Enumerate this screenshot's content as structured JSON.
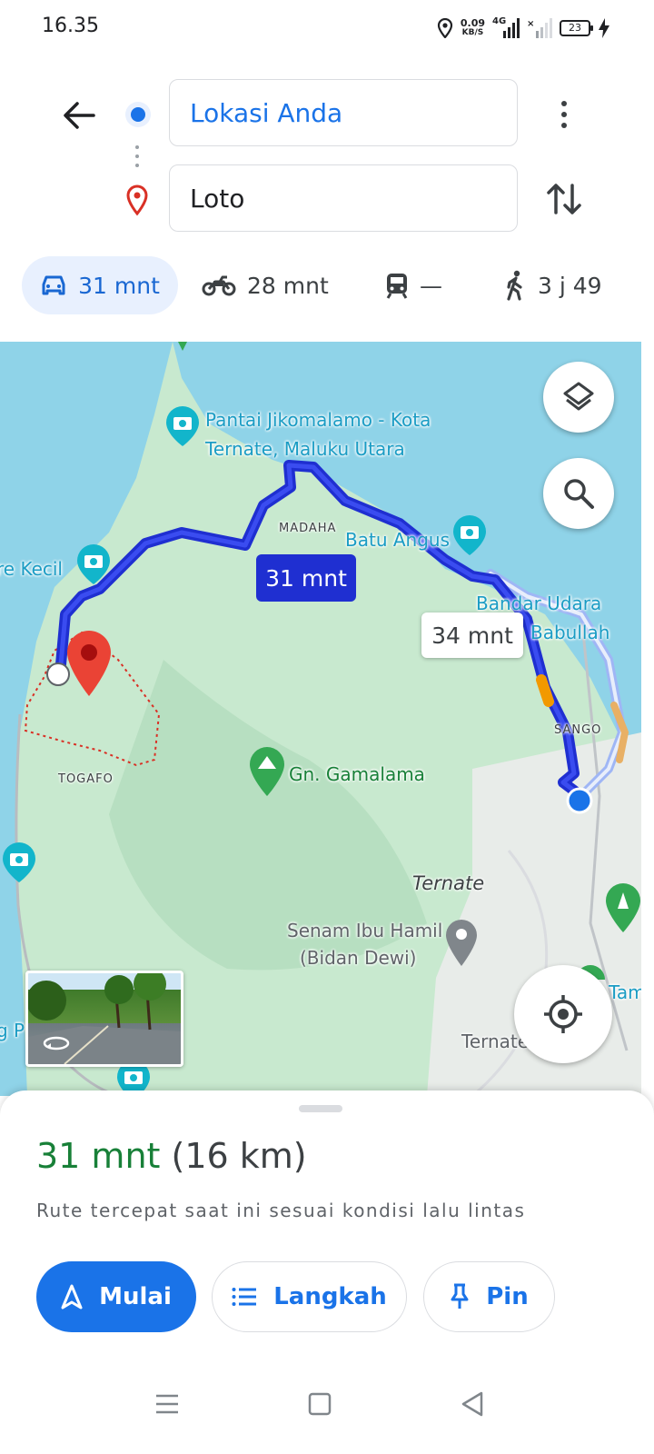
{
  "status_bar": {
    "time": "16.35",
    "net_speed_value": "0.09",
    "net_speed_unit": "KB/S",
    "network_type": "4G",
    "battery": "23"
  },
  "directions": {
    "origin": "Lokasi Anda",
    "destination": "Loto"
  },
  "modes": [
    {
      "name": "car",
      "time": "31 mnt",
      "active": true
    },
    {
      "name": "motorcycle",
      "time": "28 mnt",
      "active": false
    },
    {
      "name": "transit",
      "time": "—",
      "active": false
    },
    {
      "name": "walk",
      "time": "3 j 49",
      "active": false
    }
  ],
  "map": {
    "labels": {
      "pantai_1": "Pantai Jikomalamo - Kota",
      "pantai_2": "Ternate, Maluku Utara",
      "madaha": "MADAHA",
      "batu_angus": "Batu Angus",
      "bandara_1": "Bandar Udara",
      "bandara_2": "Babullah",
      "re_kecil": "re Kecil",
      "sango": "SANGO",
      "togafo": "TOGAFO",
      "gamalama": "Gn. Gamalama",
      "ternate_mid": "Ternate",
      "senam_1": "Senam Ibu Hamil",
      "senam_2": "(Bidan Dewi)",
      "ternate_bottom": "Ternate",
      "tam": "Tam",
      "g_p": "g P"
    },
    "route_primary_duration": "31 mnt",
    "route_alt_duration": "34 mnt",
    "colors": {
      "route": "#1f2fd1",
      "route_alt": "#9fb6f5",
      "water": "#8fd3e8",
      "land": "#c5e6cf",
      "pin": "#d93025"
    }
  },
  "sheet": {
    "duration": "31 mnt",
    "distance": "(16 km)",
    "note": "Rute tercepat saat ini sesuai kondisi lalu lintas",
    "buttons": {
      "start": "Mulai",
      "steps": "Langkah",
      "pin": "Pin"
    }
  }
}
